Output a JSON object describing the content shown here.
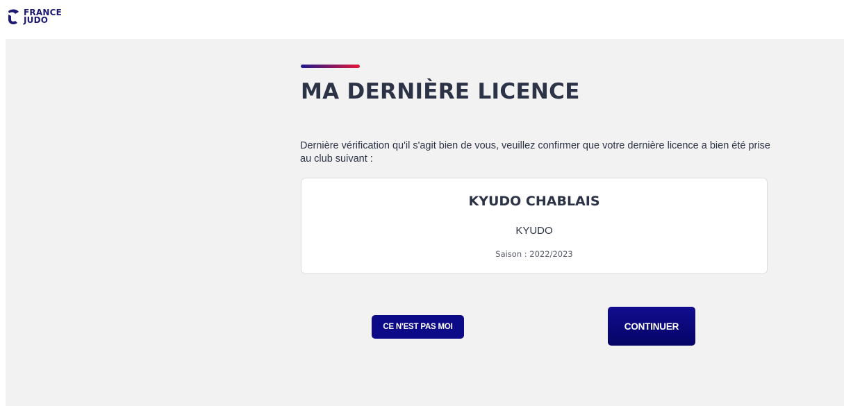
{
  "header": {
    "logo": {
      "line1": "FRANCE",
      "line2": "JUDO",
      "icon": "france-judo-logo-icon"
    }
  },
  "main": {
    "title": "MA DERNIÈRE LICENCE",
    "intro": "Dernière vérification qu'il s'agit bien de vous, veuillez confirmer que votre dernière licence a bien été prise au club suivant :",
    "club": {
      "name": "KYUDO CHABLAIS",
      "discipline": "KYUDO",
      "season": "Saison : 2022/2023"
    },
    "buttons": {
      "not_me": "CE N'EST PAS MOI",
      "continue": "CONTINUER"
    }
  },
  "colors": {
    "brand_navy": "#0d0a87",
    "accent_red": "#e3173c",
    "text_dark": "#2c3347",
    "background": "#f2f2f2"
  }
}
